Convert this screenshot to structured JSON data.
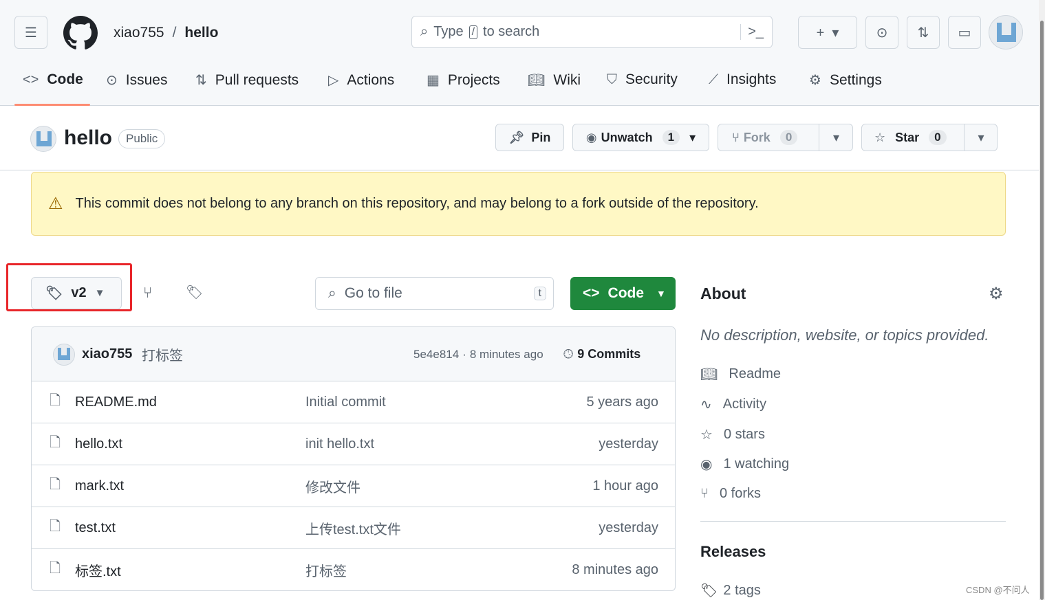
{
  "header": {
    "owner": "xiao755",
    "separator": "/",
    "repo": "hello",
    "search_prefix": "Type",
    "search_key": "/",
    "search_suffix": "to search"
  },
  "nav": {
    "tabs": [
      {
        "label": "Code",
        "icon": "code-icon"
      },
      {
        "label": "Issues",
        "icon": "issue-icon"
      },
      {
        "label": "Pull requests",
        "icon": "pr-icon"
      },
      {
        "label": "Actions",
        "icon": "play-icon"
      },
      {
        "label": "Projects",
        "icon": "table-icon"
      },
      {
        "label": "Wiki",
        "icon": "book-icon"
      },
      {
        "label": "Security",
        "icon": "shield-icon"
      },
      {
        "label": "Insights",
        "icon": "graph-icon"
      },
      {
        "label": "Settings",
        "icon": "gear-icon"
      }
    ],
    "active": "Code"
  },
  "repo": {
    "name": "hello",
    "visibility": "Public",
    "pin": "Pin",
    "unwatch": "Unwatch",
    "watch_count": "1",
    "fork": "Fork",
    "fork_count": "0",
    "star": "Star",
    "star_count": "0"
  },
  "banner": {
    "text": "This commit does not belong to any branch on this repository, and may belong to a fork outside of the repository."
  },
  "toolbar": {
    "ref": "v2",
    "goto_placeholder": "Go to file",
    "goto_key": "t",
    "code_button": "Code"
  },
  "commit": {
    "author": "xiao755",
    "message": "打标签",
    "sha": "5e4e814",
    "dot": "·",
    "time": "8 minutes ago",
    "commits": "9 Commits"
  },
  "files": [
    {
      "name": "README.md",
      "message": "Initial commit",
      "time": "5 years ago"
    },
    {
      "name": "hello.txt",
      "message": "init hello.txt",
      "time": "yesterday"
    },
    {
      "name": "mark.txt",
      "message": "修改文件",
      "time": "1 hour ago"
    },
    {
      "name": "test.txt",
      "message": "上传test.txt文件",
      "time": "yesterday"
    },
    {
      "name": "标签.txt",
      "message": "打标签",
      "time": "8 minutes ago"
    }
  ],
  "about": {
    "title": "About",
    "description": "No description, website, or topics provided.",
    "items": [
      {
        "label": "Readme"
      },
      {
        "label": "Activity"
      },
      {
        "label": "0 stars"
      },
      {
        "label": "1 watching"
      },
      {
        "label": "0 forks"
      }
    ],
    "releases": "Releases",
    "tags": "2 tags"
  },
  "watermark": "CSDN @不问人",
  "colors": {
    "accent_green": "#1f883d",
    "banner_bg": "#fff8c5",
    "highlight_red": "#e8262a",
    "active_tab": "#fd8c73"
  }
}
